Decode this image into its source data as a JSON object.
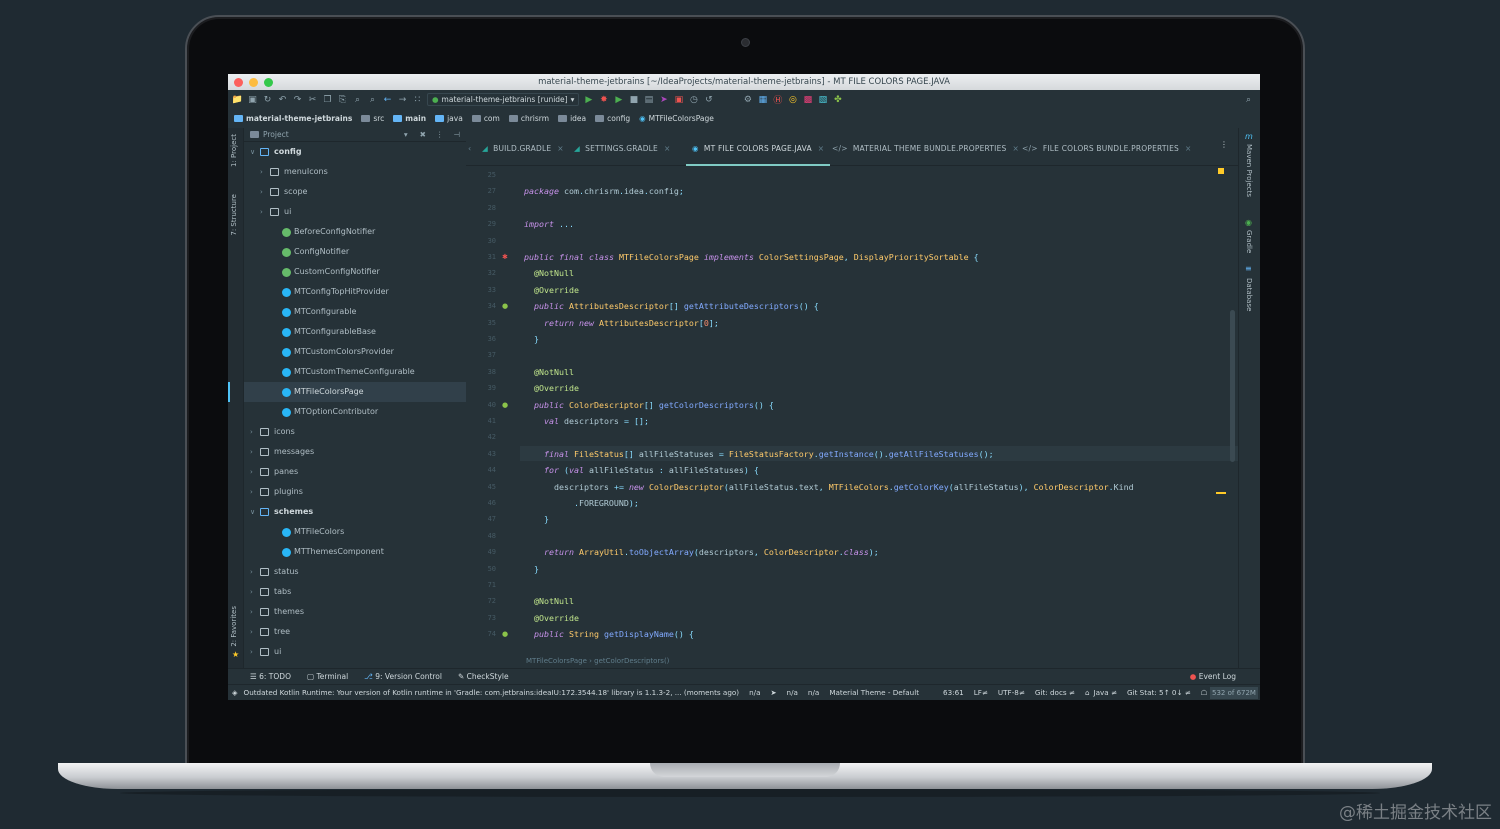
{
  "window": {
    "title": "material-theme-jetbrains [~/IdeaProjects/material-theme-jetbrains] - MT FILE COLORS PAGE.JAVA"
  },
  "toolbar": {
    "run_config": "material-theme-jetbrains [runide]"
  },
  "navbar": {
    "crumbs": [
      "material-theme-jetbrains",
      "src",
      "main",
      "java",
      "com",
      "chrisrm",
      "idea",
      "config",
      "MTFileColorsPage"
    ]
  },
  "project_panel": {
    "header": "Project",
    "tree": [
      {
        "label": "config",
        "type": "folder",
        "expanded": true
      },
      {
        "label": "menuIcons",
        "type": "folder"
      },
      {
        "label": "scope",
        "type": "folder"
      },
      {
        "label": "ui",
        "type": "folder"
      },
      {
        "label": "BeforeConfigNotifier",
        "type": "interface"
      },
      {
        "label": "ConfigNotifier",
        "type": "interface"
      },
      {
        "label": "CustomConfigNotifier",
        "type": "interface"
      },
      {
        "label": "MTConfigTopHitProvider",
        "type": "class"
      },
      {
        "label": "MTConfigurable",
        "type": "class"
      },
      {
        "label": "MTConfigurableBase",
        "type": "class"
      },
      {
        "label": "MTCustomColorsProvider",
        "type": "class"
      },
      {
        "label": "MTCustomThemeConfigurable",
        "type": "class"
      },
      {
        "label": "MTFileColorsPage",
        "type": "class",
        "selected": true
      },
      {
        "label": "MTOptionContributor",
        "type": "class"
      },
      {
        "label": "icons",
        "type": "folder"
      },
      {
        "label": "messages",
        "type": "folder"
      },
      {
        "label": "panes",
        "type": "folder"
      },
      {
        "label": "plugins",
        "type": "folder"
      },
      {
        "label": "schemes",
        "type": "folder",
        "expanded": true
      },
      {
        "label": "MTFileColors",
        "type": "class"
      },
      {
        "label": "MTThemesComponent",
        "type": "class"
      },
      {
        "label": "status",
        "type": "folder"
      },
      {
        "label": "tabs",
        "type": "folder"
      },
      {
        "label": "themes",
        "type": "folder"
      },
      {
        "label": "tree",
        "type": "folder"
      },
      {
        "label": "ui",
        "type": "folder"
      }
    ]
  },
  "side_labels": {
    "project": "1: Project",
    "structure": "7: Structure",
    "favorites": "2: Favorites",
    "maven": "Maven Projects",
    "gradle": "Gradle",
    "database": "Database"
  },
  "editor": {
    "tabs": [
      {
        "label": "BUILD.GRADLE",
        "active": false
      },
      {
        "label": "SETTINGS.GRADLE",
        "active": false
      },
      {
        "label": "MT FILE COLORS PAGE.JAVA",
        "active": true
      },
      {
        "label": "MATERIAL THEME BUNDLE.PROPERTIES",
        "active": false
      },
      {
        "label": "FILE COLORS BUNDLE.PROPERTIES",
        "active": false
      }
    ],
    "line_numbers": [
      "25",
      "27",
      "28",
      "29",
      "30",
      "31",
      "32",
      "33",
      "34",
      "35",
      "36",
      "37",
      "38",
      "39",
      "40",
      "41",
      "42",
      "43",
      "44",
      "45",
      "46",
      "47",
      "48",
      "49",
      "50",
      "71",
      "72",
      "73",
      "74"
    ],
    "lines": [
      "",
      "package com.chrisrm.idea.config;",
      "",
      "import ...",
      "",
      "public final class MTFileColorsPage implements ColorSettingsPage, DisplayPrioritySortable {",
      "  @NotNull",
      "  @Override",
      "  public AttributesDescriptor[] getAttributeDescriptors() {",
      "    return new AttributesDescriptor[0];",
      "  }",
      "",
      "  @NotNull",
      "  @Override",
      "  public ColorDescriptor[] getColorDescriptors() {",
      "    val descriptors = [];",
      "",
      "    final FileStatus[] allFileStatuses = FileStatusFactory.getInstance().getAllFileStatuses();",
      "    for (val allFileStatus : allFileStatuses) {",
      "      descriptors += new ColorDescriptor(allFileStatus.text, MTFileColors.getColorKey(allFileStatus), ColorDescriptor.Kind",
      "          .FOREGROUND);",
      "    }",
      "",
      "    return ArrayUtil.toObjectArray(descriptors, ColorDescriptor.class);",
      "  }",
      "",
      "  @NotNull",
      "  @Override",
      "  public String getDisplayName() {"
    ],
    "breadcrumb": [
      "MTFileColorsPage",
      "getColorDescriptors()"
    ]
  },
  "tool_windows": [
    "6: TODO",
    "Terminal",
    "9: Version Control",
    "CheckStyle",
    "Event Log"
  ],
  "status_bar": {
    "message": "Outdated Kotlin Runtime: Your version of Kotlin runtime in 'Gradle: com.jetbrains:ideaIU:172.3544.18' library is 1.1.3-2, ... (moments ago)",
    "na1": "n/a",
    "na2": "n/a",
    "na3": "n/a",
    "theme": "Material Theme - Default",
    "position": "63:61",
    "line_sep": "LF≠",
    "encoding": "UTF-8≠",
    "git": "Git: docs ≠",
    "lang": "Java ≠",
    "git_stat": "Git Stat: 5↑ 0↓ ≠",
    "memory": "532 of 672M"
  },
  "watermark": "@稀土掘金技术社区",
  "colors": {
    "background": "#263238",
    "accent": "#80cbc4",
    "keyword": "#c792ea",
    "type": "#ffcb6b",
    "function": "#82aaff"
  }
}
